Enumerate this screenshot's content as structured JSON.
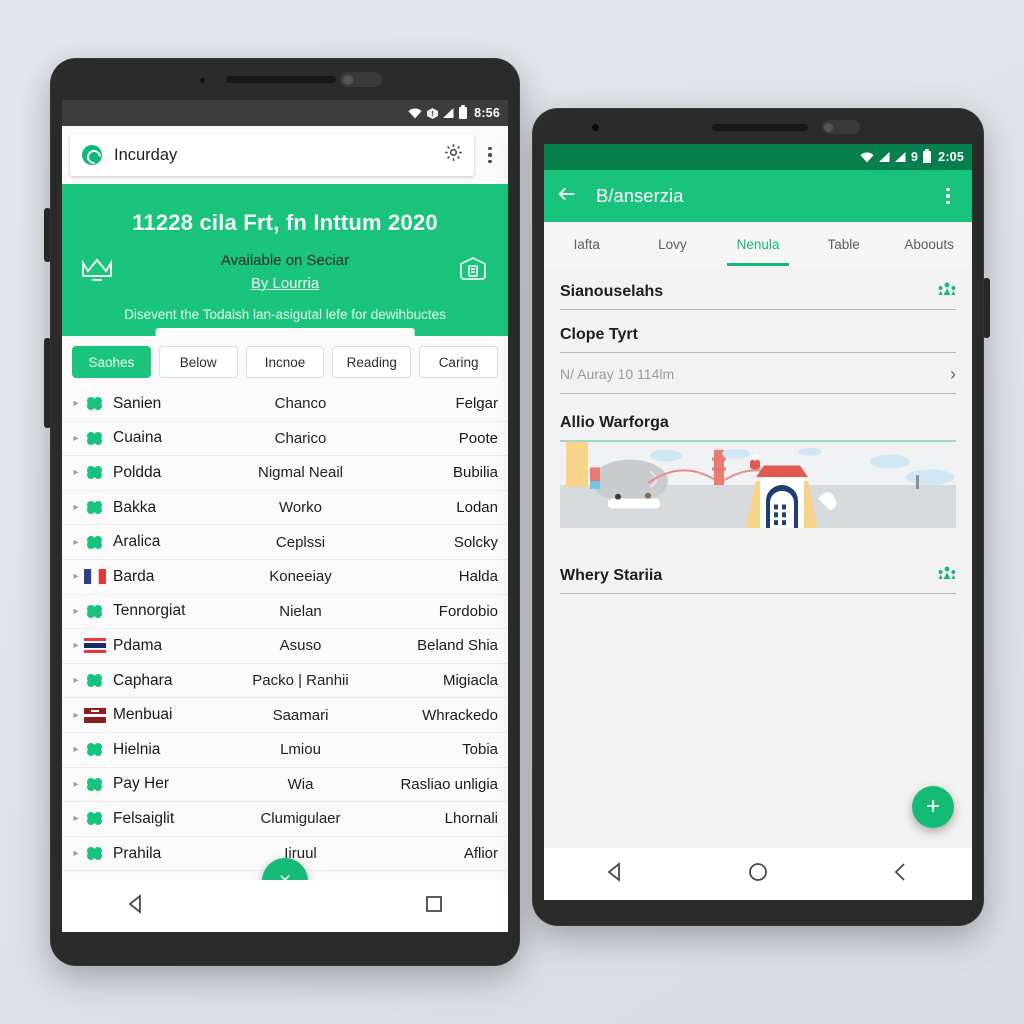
{
  "left_phone": {
    "statusbar": {
      "time": "8:56",
      "wifi_icon": "wifi-icon",
      "signal_icon": "signal-icon",
      "battery_icon": "battery-icon"
    },
    "search": {
      "app_icon": "app-logo-icon",
      "value": "Incurday",
      "gear_icon": "gear-icon",
      "overflow_icon": "overflow-menu-icon"
    },
    "hero": {
      "title": "11228 cila Frt, fn Inttum 2020",
      "badge_left_icon": "crown-icon",
      "subtitle": "Available on Seciar",
      "link": "By Lourria",
      "badge_right_icon": "certificate-icon",
      "footer": "Disevent the Todalsh lan-asigutal lefe for dewihbuctes"
    },
    "chips": [
      {
        "label": "Saohes",
        "active": true
      },
      {
        "label": "Below",
        "active": false
      },
      {
        "label": "Incnoe",
        "active": false
      },
      {
        "label": "Reading",
        "active": false
      },
      {
        "label": "Caring",
        "active": false
      }
    ],
    "rows": [
      {
        "flag": "green",
        "name": "Sanien",
        "mid": "Chanco",
        "right": "Felgar"
      },
      {
        "flag": "green",
        "name": "Cuaina",
        "mid": "Charico",
        "right": "Poote"
      },
      {
        "flag": "green",
        "name": "Poldda",
        "mid": "Nigmal Neail",
        "right": "Bubilia"
      },
      {
        "flag": "green",
        "name": "Bakka",
        "mid": "Worko",
        "right": "Lodan"
      },
      {
        "flag": "green",
        "name": "Aralica",
        "mid": "Ceplssi",
        "right": "Solcky"
      },
      {
        "flag": "france",
        "name": "Barda",
        "mid": "Koneeiay",
        "right": "Halda"
      },
      {
        "flag": "green",
        "name": "Tennorgiat",
        "mid": "Nielan",
        "right": "Fordobio"
      },
      {
        "flag": "thai",
        "name": "Pdama",
        "mid": "Asuso",
        "right": "Beland Shia"
      },
      {
        "flag": "green",
        "name": "Caphara",
        "mid": "Packo | Ranhii",
        "right": "Migiacla"
      },
      {
        "flag": "red",
        "name": "Menbuai",
        "mid": "Saamari",
        "right": "Whrackedo"
      },
      {
        "flag": "green",
        "name": "Hielnia",
        "mid": "Lmiou",
        "right": "Tobia"
      },
      {
        "flag": "green",
        "name": "Pay Her",
        "mid": "Wia",
        "right": "Rasliao unligia"
      },
      {
        "flag": "green",
        "name": "Felsaiglit",
        "mid": "Clumigulaer",
        "right": "Lhornali"
      },
      {
        "flag": "green",
        "name": "Prahila",
        "mid": "Iiruul",
        "right": "Aflior"
      }
    ],
    "fab": {
      "icon": "close-x-icon",
      "glyph": "×"
    },
    "navbar": {
      "back_icon": "nav-back-triangle-icon",
      "home_icon": "nav-home-icon",
      "recents_icon": "nav-recents-square-icon"
    }
  },
  "right_phone": {
    "statusbar": {
      "time": "2:05",
      "count": "9",
      "wifi_icon": "wifi-icon",
      "signal_icon": "signal-icon",
      "battery_icon": "battery-icon"
    },
    "appbar": {
      "back_icon": "back-arrow-icon",
      "title": "B/anserzia",
      "overflow_icon": "overflow-menu-icon"
    },
    "tabs": [
      {
        "label": "Iafta",
        "active": false
      },
      {
        "label": "Lovy",
        "active": false
      },
      {
        "label": "Nenula",
        "active": true
      },
      {
        "label": "Table",
        "active": false
      },
      {
        "label": "Aboouts",
        "active": false
      }
    ],
    "sections": [
      {
        "title": "Sianouselahs",
        "icon": "people-group-icon"
      },
      {
        "title": "Clope Tyrt",
        "icon": ""
      }
    ],
    "field": {
      "value": "N/ Auray 10 114lm",
      "chevron_icon": "chevron-right-icon"
    },
    "illustration": {
      "label": "Allio Warforga",
      "icon": "city-illustration"
    },
    "section_bottom": {
      "title": "Whery Stariia",
      "icon": "people-group-icon"
    },
    "fab": {
      "icon": "plus-icon",
      "glyph": "+"
    },
    "navbar": {
      "back_icon": "nav-back-triangle-icon",
      "home_icon": "nav-home-circle-icon",
      "recents_icon": "nav-chevron-left-icon"
    }
  },
  "colors": {
    "accent_green": "#1bc47d",
    "appbar_green": "#19c37d",
    "statusbar_dark": "#3c3c3c",
    "statusbar_green": "#087f4f",
    "page_bg": "#f2f2f2"
  }
}
